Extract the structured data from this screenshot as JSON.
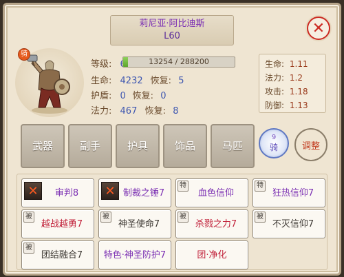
{
  "character": {
    "name": "莉尼亚·阿比迪斯",
    "level": "L60",
    "ride_badge": "骑"
  },
  "stats": {
    "level_label": "等级:",
    "level_value": "60",
    "exp_text": "13254 / 288200",
    "exp_progress": 0.046,
    "hp_label": "生命:",
    "hp_value": "4232",
    "hp_regen_label": "恢复:",
    "hp_regen_value": "5",
    "shield_label": "护盾:",
    "shield_value": "0",
    "shield_regen_label": "恢复:",
    "shield_regen_value": "0",
    "mp_label": "法力:",
    "mp_value": "467",
    "mp_regen_label": "恢复:",
    "mp_regen_value": "8"
  },
  "multipliers": [
    {
      "label": "生命:",
      "value": "1.11"
    },
    {
      "label": "法力:",
      "value": "1.2"
    },
    {
      "label": "攻击:",
      "value": "1.18"
    },
    {
      "label": "防御:",
      "value": "1.13"
    }
  ],
  "equipment": [
    "武器",
    "副手",
    "护具",
    "饰品",
    "马匹"
  ],
  "ride_emblem": {
    "number": "9",
    "label": "骑"
  },
  "adjust_label": "调整",
  "skills": [
    {
      "tag": "",
      "has_icon": true,
      "name": "审判8",
      "color": "#7b2fb3"
    },
    {
      "tag": "",
      "has_icon": true,
      "name": "制裁之锤7",
      "color": "#7b2fb3"
    },
    {
      "tag": "特",
      "has_icon": false,
      "name": "血色信仰",
      "color": "#7b2fb3"
    },
    {
      "tag": "特",
      "has_icon": false,
      "name": "狂热信仰7",
      "color": "#7b2fb3"
    },
    {
      "tag": "被",
      "has_icon": false,
      "name": "越战越勇7",
      "color": "#c1213a"
    },
    {
      "tag": "被",
      "has_icon": false,
      "name": "神圣使命7",
      "color": "#3d3833"
    },
    {
      "tag": "被",
      "has_icon": false,
      "name": "杀戮之力7",
      "color": "#c1213a"
    },
    {
      "tag": "被",
      "has_icon": false,
      "name": "不灭信仰7",
      "color": "#3d3833"
    },
    {
      "tag": "被",
      "has_icon": false,
      "name": "团结融合7",
      "color": "#3d3833"
    },
    {
      "tag": "",
      "has_icon": false,
      "name": "特色·神圣防护7",
      "color": "#7b2fb3"
    },
    {
      "tag": "",
      "has_icon": false,
      "name": "团·净化",
      "color": "#c1213a"
    }
  ]
}
